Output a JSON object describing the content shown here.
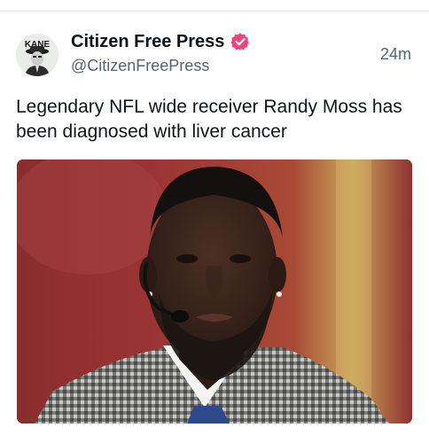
{
  "post": {
    "author": {
      "display_name": "Citizen Free Press",
      "handle": "@CitizenFreePress",
      "verified": true,
      "avatar_text": "KANE"
    },
    "timestamp": "24m",
    "text": "Legendary NFL wide receiver Randy Moss has been diagnosed with liver cancer",
    "media": {
      "icon": "photo"
    }
  },
  "colors": {
    "text": "#0f1419",
    "secondary": "#536471",
    "verified_badge": "#f0457a"
  }
}
